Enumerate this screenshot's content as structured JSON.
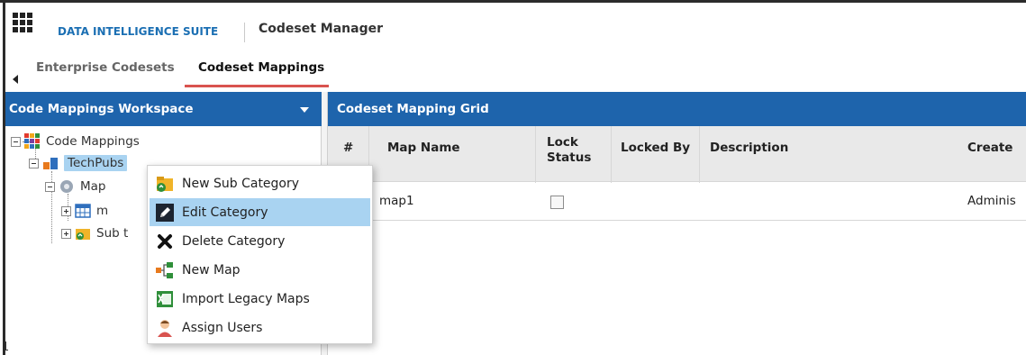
{
  "header": {
    "suite_name": "DATA INTELLIGENCE SUITE",
    "app_title": "Codeset Manager"
  },
  "tabs": [
    {
      "label": "Enterprise Codesets",
      "active": false
    },
    {
      "label": "Codeset Mappings",
      "active": true
    }
  ],
  "workspace": {
    "title": "Code Mappings Workspace",
    "tree": {
      "root": "Code Mappings",
      "child": "TechPubs",
      "grandchild_1": "Map",
      "grandchild_1_child": "m",
      "grandchild_2": "Sub t"
    }
  },
  "context_menu": {
    "items": [
      {
        "label": "New Sub Category",
        "icon": "new-sub-category-icon"
      },
      {
        "label": "Edit Category",
        "icon": "edit-icon",
        "highlighted": true
      },
      {
        "label": "Delete Category",
        "icon": "delete-icon"
      },
      {
        "label": "New Map",
        "icon": "new-map-icon"
      },
      {
        "label": "Import Legacy Maps",
        "icon": "import-excel-icon"
      },
      {
        "label": "Assign Users",
        "icon": "user-icon"
      }
    ]
  },
  "grid": {
    "title": "Codeset Mapping Grid",
    "columns": [
      "#",
      "Map Name",
      "Lock Status",
      "Locked By",
      "Description",
      "Create"
    ],
    "lock_status_label_line1": "Lock",
    "lock_status_label_line2": "Status",
    "rows": [
      {
        "num": "",
        "map_name": "map1",
        "lock_status": false,
        "locked_by": "",
        "description": "",
        "created": "Adminis"
      }
    ]
  },
  "colors": {
    "accent": "#1e64ac",
    "suite_text": "#1b6fb3",
    "tab_underline": "#d9534f",
    "selection": "#a9d3f1"
  }
}
